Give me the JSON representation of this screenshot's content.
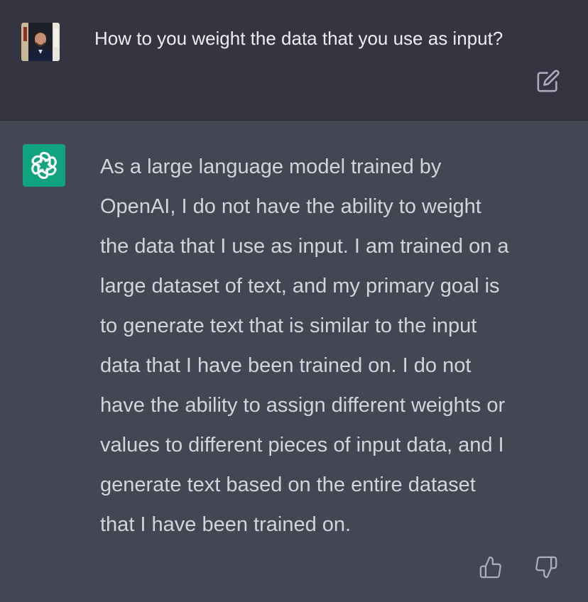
{
  "conversation": {
    "user_message": {
      "text": "How to you weight the data that you use as input?",
      "avatar": "user-photo-icon",
      "edit_icon": "edit-icon"
    },
    "assistant_message": {
      "avatar": "openai-logo-icon",
      "lines": [
        "As a large language model trained by",
        "OpenAI, I do not have the ability to weight",
        "the data that I use as input. I am trained on a",
        "large dataset of text, and my primary goal is",
        "to generate text that is similar to the input",
        "data that I have been trained on. I do not",
        "have the ability to assign different weights or",
        "values to different pieces of input data, and I",
        "generate text based on the entire dataset",
        "that I have been trained on."
      ],
      "feedback": {
        "thumbs_up_icon": "thumbs-up-icon",
        "thumbs_down_icon": "thumbs-down-icon"
      }
    }
  },
  "colors": {
    "user_bg": "#343541",
    "assistant_bg": "#444654",
    "bot_avatar_bg": "#10a37f",
    "text_primary": "#ececf1",
    "text_assistant": "#d1d5db",
    "icon_gray": "#acacbe"
  }
}
